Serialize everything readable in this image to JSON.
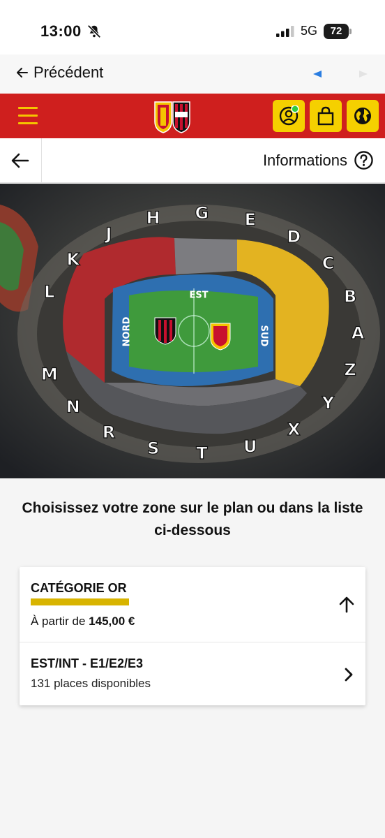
{
  "status_bar": {
    "time": "13:00",
    "network": "5G",
    "battery": "72"
  },
  "back_bar": {
    "back_label": "Précédent"
  },
  "info_bar": {
    "label": "Informations"
  },
  "map": {
    "sides": {
      "top": "EST",
      "left": "NORD",
      "right": "SUD"
    },
    "ring_letters": [
      "L",
      "K",
      "J",
      "H",
      "G",
      "E",
      "D",
      "C",
      "B",
      "A",
      "Z",
      "Y",
      "X",
      "U",
      "T",
      "S",
      "R",
      "N",
      "M"
    ]
  },
  "heading": "Choisissez votre zone sur le plan ou dans la liste ci-dessous",
  "category": {
    "title": "CATÉGORIE OR",
    "price_prefix": "À partir de",
    "price": "145,00 €",
    "accent": "#d8b400"
  },
  "zone": {
    "title": "EST/INT - E1/E2/E3",
    "availability": "131 places disponibles"
  },
  "colors": {
    "header_red": "#cf1f1e",
    "header_yellow": "#f5d000"
  }
}
